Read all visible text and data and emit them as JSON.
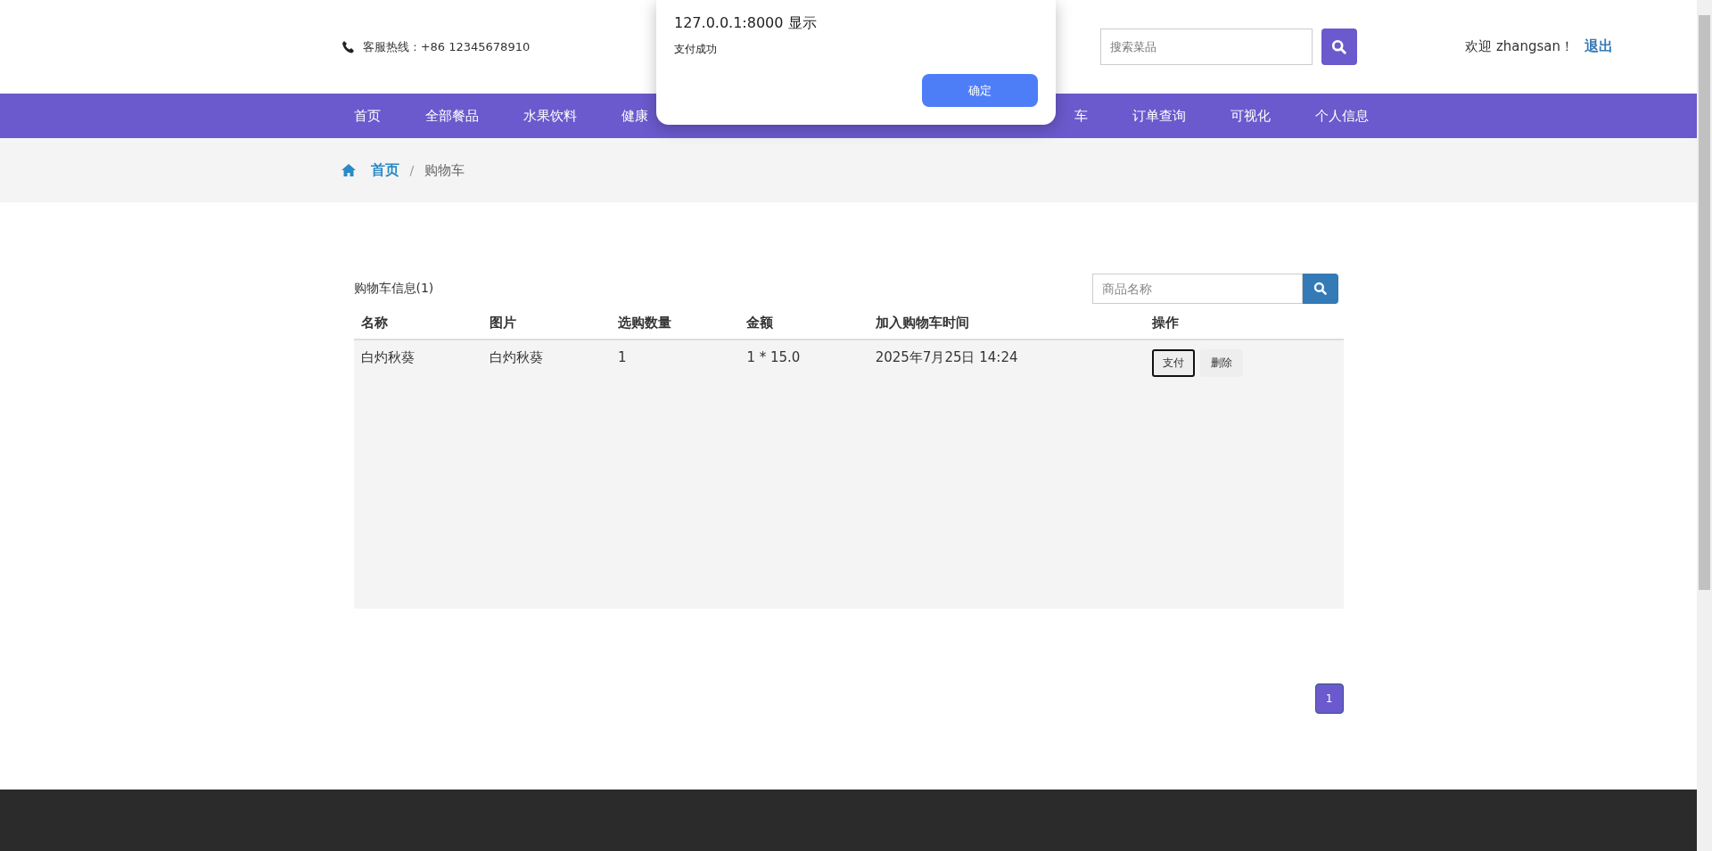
{
  "header": {
    "hotline": "客服热线 : +86 12345678910",
    "search": {
      "placeholder": "搜索菜品"
    },
    "welcome": "欢迎 zhangsan！",
    "logout": "退出"
  },
  "nav": [
    {
      "label": "首页",
      "kind": "item"
    },
    {
      "label": "全部餐品",
      "kind": "item"
    },
    {
      "label": "水果饮料",
      "kind": "item"
    },
    {
      "label": "健康",
      "kind": "item"
    },
    {
      "kind": "gap"
    },
    {
      "label": "车",
      "kind": "item"
    },
    {
      "label": "订单查询",
      "kind": "item"
    },
    {
      "label": "可视化",
      "kind": "item"
    },
    {
      "label": "个人信息",
      "kind": "item"
    }
  ],
  "breadcrumb": {
    "home": "首页",
    "separator": "/",
    "current": "购物车"
  },
  "cart": {
    "title": "购物车信息(1)",
    "search": {
      "placeholder": "商品名称"
    },
    "columns": [
      "名称",
      "图片",
      "选购数量",
      "金额",
      "加入购物车时间",
      "操作"
    ],
    "rows": [
      {
        "cells": [
          "白灼秋葵",
          "白灼秋葵",
          "1",
          "1 * 15.0",
          "2025年7月25日 14:24"
        ],
        "actions": [
          {
            "label": "支付",
            "focused": true
          },
          {
            "label": "删除",
            "focused": false
          }
        ]
      }
    ]
  },
  "pagination": [
    {
      "label": "1",
      "selected": true
    }
  ],
  "dialog": {
    "title": "127.0.0.1:8000 显示",
    "message": "支付成功",
    "button": "确定"
  }
}
